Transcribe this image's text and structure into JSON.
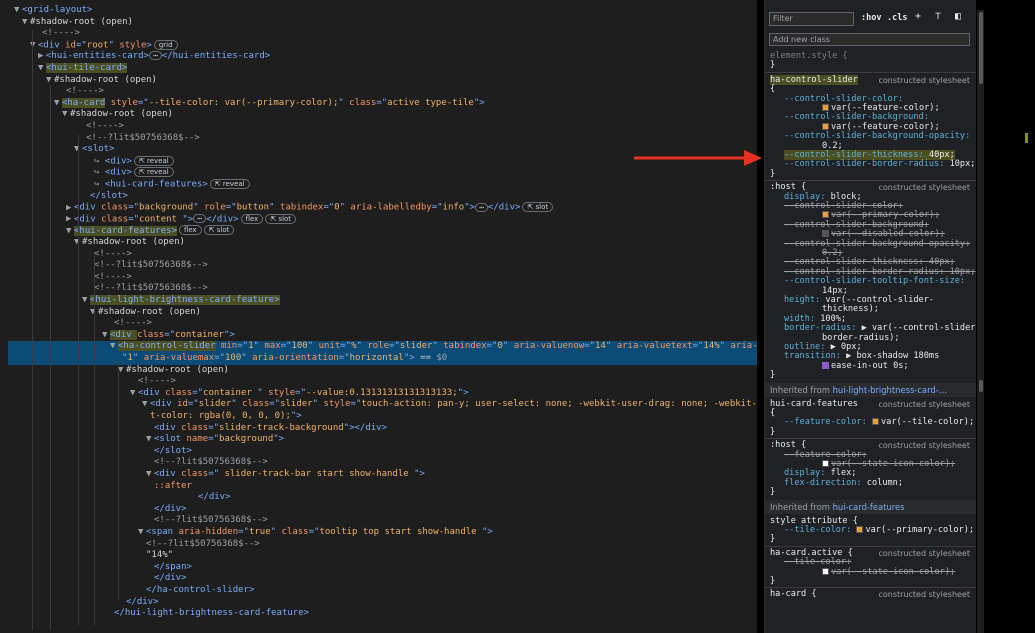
{
  "elements_panel": {
    "lines": [
      {
        "html": "<span class='tri'>▼</span><span class='tag'>&lt;grid-layout&gt;</span>"
      },
      {
        "html": "<span class='tri'>▼</span><span class='code'>#shadow-root (open)</span>"
      },
      {
        "html": "<span class='tri'></span><span class='cmt'>&lt;!----&gt;</span>"
      },
      {
        "html": "<span class='tri'>▼</span><span class='tag'>&lt;div </span><span class='attr'>id</span><span class='tag'>=\"</span><span class='val'>root</span><span class='tag'>\" </span><span class='attr'>style</span><span class='tag'>&gt;</span><span class='pill'>grid</span>"
      },
      {
        "html": "<span class='tri'>▶</span><span class='tag'>&lt;hui-entities-card&gt;</span><span class='ell'>⋯</span><span class='tag'>&lt;/hui-entities-card&gt;</span>"
      },
      {
        "html": "<span class='tri'>▼</span><span class='hl-tag'>&lt;hui-tile-card&gt;</span>"
      },
      {
        "html": "<span class='tri'>▼</span><span class='code'>#shadow-root (open)</span>"
      },
      {
        "html": "<span class='tri'></span><span class='cmt'>&lt;!----&gt;</span>"
      },
      {
        "html": "<span class='tri'>▼</span><span class='hl-tag'>&lt;ha-card</span><span class='tag'> </span><span class='attr'>style</span><span class='tag'>=\"</span><span class='val'>--tile-color: var(--primary-color);</span><span class='tag'>\" </span><span class='attr'>class</span><span class='tag'>=\"</span><span class='val'>active type-tile</span><span class='tag'>\"&gt;</span>"
      },
      {
        "html": "<span class='tri'>▼</span><span class='code'>#shadow-root (open)</span>"
      },
      {
        "html": "<span class='tri'></span><span class='cmt'>&lt;!----&gt;</span>"
      },
      {
        "html": "<span class='tri'></span><span class='cmt'>&lt;!--?lit$50756368$--&gt;</span>"
      },
      {
        "html": "<span class='tri'>▼</span><span class='tag'>&lt;slot&gt;</span>"
      },
      {
        "html": "<span class='tri'></span><span class='cmt'>↪ </span><span class='tag'>&lt;div&gt;</span><span class='pill'>⇱ reveal</span>"
      },
      {
        "html": "<span class='tri'></span><span class='cmt'>↪ </span><span class='tag'>&lt;div&gt;</span><span class='pill'>⇱ reveal</span>"
      },
      {
        "html": "<span class='tri'></span><span class='cmt'>↪ </span><span class='tag'>&lt;hui-card-features&gt;</span><span class='pill'>⇱ reveal</span>"
      },
      {
        "html": "<span class='tri'></span><span class='tag'>&lt;/slot&gt;</span>"
      },
      {
        "html": "<span class='tri'>▶</span><span class='tag'>&lt;div </span><span class='attr'>class</span><span class='tag'>=\"</span><span class='val'>background</span><span class='tag'>\" </span><span class='attr'>role</span><span class='tag'>=\"</span><span class='val'>button</span><span class='tag'>\" </span><span class='attr'>tabindex</span><span class='tag'>=\"</span><span class='val'>0</span><span class='tag'>\" </span><span class='attr'>aria-labelledby</span><span class='tag'>=\"</span><span class='val'>info</span><span class='tag'>\"&gt;</span><span class='ell'>⋯</span><span class='tag'>&lt;/div&gt;</span><span class='pill'>⇱ slot</span>"
      },
      {
        "html": "<span class='tri'>▶</span><span class='tag'>&lt;div </span><span class='attr'>class</span><span class='tag'>=\"</span><span class='val'>content   </span><span class='tag'>\"&gt;</span><span class='ell'>⋯</span><span class='tag'>&lt;/div&gt;</span><span class='pill'>flex</span><span class='pill'>⇱ slot</span>"
      },
      {
        "html": "<span class='tri'>▼</span><span class='hl-tag'>&lt;hui-card-features&gt;</span><span class='pill'>flex</span><span class='pill'>⇱ slot</span>"
      },
      {
        "html": "<span class='tri'>▼</span><span class='code'>#shadow-root (open)</span>"
      },
      {
        "html": "<span class='tri'></span><span class='cmt'>&lt;!----&gt;</span>"
      },
      {
        "html": "<span class='tri'></span><span class='cmt'>&lt;!--?lit$50756368$--&gt;</span>"
      },
      {
        "html": "<span class='tri'></span><span class='cmt'>&lt;!----&gt;</span>"
      },
      {
        "html": "<span class='tri'></span><span class='cmt'>&lt;!--?lit$50756368$--&gt;</span>"
      },
      {
        "html": "<span class='tri'>▼</span><span class='hl-tag'>&lt;hui-light-brightness-card-feature&gt;</span>"
      },
      {
        "html": "<span class='tri'>▼</span><span class='code'>#shadow-root (open)</span>"
      },
      {
        "html": "<span class='tri'></span><span class='cmt'>&lt;!----&gt;</span>"
      },
      {
        "html": "<span class='tri'>▼</span><span class='hl-tag'>&lt;div </span><span class='attr'>class</span><span class='tag'>=\"</span><span class='val'>container</span><span class='tag'>\"&gt;</span>"
      },
      {
        "html": "<span class='tri'>▼</span><span class='hl-tag'>&lt;ha-control-slider</span><span class='tag'> </span><span class='attr'>min</span><span class='tag'>=\"</span><span class='val'>1</span><span class='tag'>\" </span><span class='attr'>max</span><span class='tag'>=\"</span><span class='val'>100</span><span class='tag'>\" </span><span class='attr'>unit</span><span class='tag'>=\"</span><span class='val'>%</span><span class='tag'>\" </span><span class='attr'>role</span><span class='tag'>=\"</span><span class='val'>slider</span><span class='tag'>\" </span><span class='attr'>tabindex</span><span class='tag'>=\"</span><span class='val'>0</span><span class='tag'>\" </span><span class='attr'>aria-valuenow</span><span class='tag'>=\"</span><span class='val'>14</span><span class='tag'>\" </span><span class='attr'>aria-valuetext</span><span class='tag'>=\"</span><span class='val'>14%</span><span class='tag'>\" </span><span class='attr'>aria-valuemin</span><span class='tag'>=</span>"
      },
      {
        "html": "<span class='tri'></span><span class='tag'>\"</span><span class='val'>1</span><span class='tag'>\" </span><span class='attr'>aria-valuemax</span><span class='tag'>=\"</span><span class='val'>100</span><span class='tag'>\" </span><span class='attr'>aria-orientation</span><span class='tag'>=\"</span><span class='val'>horizontal</span><span class='tag'>\"&gt;</span><span class='code'> == </span><span class='cmt'>$0</span>"
      },
      {
        "html": "<span class='tri'>▼</span><span class='code'>#shadow-root (open)</span>"
      },
      {
        "html": "<span class='tri'></span><span class='cmt'>&lt;!----&gt;</span>"
      },
      {
        "html": "<span class='tri'>▼</span><span class='tag'>&lt;div </span><span class='attr'>class</span><span class='tag'>=\"</span><span class='val'>container  </span><span class='tag'>\" </span><span class='attr'>style</span><span class='tag'>=\"</span><span class='val'>--value:0.13131313131313133;</span><span class='tag'>\"&gt;</span>"
      },
      {
        "html": "<span class='tri'>▼</span><span class='tag'>&lt;div </span><span class='attr'>id</span><span class='tag'>=\"</span><span class='val'>slider</span><span class='tag'>\" </span><span class='attr'>class</span><span class='tag'>=\"</span><span class='val'>slider</span><span class='tag'>\" </span><span class='attr'>style</span><span class='tag'>=\"</span><span class='val'>touch-action: pan-y; user-select: none; -webkit-user-drag: none; -webkit-tap-highligh</span>"
      },
      {
        "html": "<span class='tri'></span><span class='val'>t-color: rgba(0, 0, 0, 0);</span><span class='tag'>\"&gt;</span>"
      },
      {
        "html": "<span class='tri'></span><span class='tag'>&lt;div </span><span class='attr'>class</span><span class='tag'>=\"</span><span class='val'>slider-track-background</span><span class='tag'>\"&gt;&lt;/div&gt;</span>"
      },
      {
        "html": "<span class='tri'>▼</span><span class='tag'>&lt;slot </span><span class='attr'>name</span><span class='tag'>=\"</span><span class='val'>background</span><span class='tag'>\"&gt;</span>"
      },
      {
        "html": "<span class='tri'></span><span class='tag'>&lt;/slot&gt;</span>"
      },
      {
        "html": "<span class='tri'></span><span class='cmt'>&lt;!--?lit$50756368$--&gt;</span>"
      },
      {
        "html": "<span class='tri'>▼</span><span class='tag'>&lt;div </span><span class='attr'>class</span><span class='tag'>=\"</span><span class='val'> slider-track-bar start show-handle </span><span class='tag'>\"&gt;</span>"
      },
      {
        "html": "<span class='tri'></span><span class='attr'>::after</span>"
      },
      {
        "html": "<span class='tri'></span><span class='tag'>&lt;/div&gt;</span>"
      },
      {
        "html": "<span class='tri'></span><span class='tag'>&lt;/div&gt;</span>"
      },
      {
        "html": "<span class='tri'></span><span class='cmt'>&lt;!--?lit$50756368$--&gt;</span>"
      },
      {
        "html": "<span class='tri'>▼</span><span class='tag'>&lt;span </span><span class='attr'>aria-hidden</span><span class='tag'>=\"</span><span class='val'>true</span><span class='tag'>\" </span><span class='attr'>class</span><span class='tag'>=\"</span><span class='val'>tooltip  top start show-handle </span><span class='tag'>\"&gt;</span>"
      },
      {
        "html": "<span class='tri'></span><span class='cmt'>&lt;!--?lit$50756368$--&gt;</span>"
      },
      {
        "html": "<span class='tri'></span><span class='code'>\"14%\"</span>"
      },
      {
        "html": "<span class='tri'></span><span class='tag'>&lt;/span&gt;</span>"
      },
      {
        "html": "<span class='tri'></span><span class='tag'>&lt;/div&gt;</span>"
      },
      {
        "html": "<span class='tri'></span><span class='tag'>&lt;/ha-control-slider&gt;</span>"
      },
      {
        "html": "<span class='tri'></span><span class='tag'>&lt;/div&gt;</span>"
      },
      {
        "html": "<span class='tri'></span><span class='tag'>&lt;/hui-light-brightness-card-feature&gt;</span>"
      }
    ]
  },
  "styles_panel": {
    "filter_placeholder": "Filter",
    "hov_label": ":hov",
    "cls_label": ".cls",
    "add_class_placeholder": "Add new class",
    "element_style": "element.style {",
    "close_brace": "}",
    "sections": {
      "ha_control_slider": {
        "selector": "ha-control-slider",
        "source": "constructed stylesheet",
        "decls": [
          {
            "prop": "--control-slider-color:",
            "value": ""
          },
          {
            "prop": "",
            "value": "var(--feature-color);",
            "swatch": "#e8a038"
          },
          {
            "prop": "--control-slider-background:",
            "value": ""
          },
          {
            "prop": "",
            "value": "var(--feature-color);",
            "swatch": "#e8a038"
          },
          {
            "prop": "--control-slider-background-opacity:",
            "value": ""
          },
          {
            "prop": "",
            "value": "0.2;"
          },
          {
            "prop": "--control-slider-thickness:",
            "value": "40px;",
            "highlight": true
          },
          {
            "prop": "--control-slider-border-radius:",
            "value": "10px;"
          }
        ]
      },
      "host": {
        "selector": ":host {",
        "source": "constructed stylesheet",
        "decls": [
          {
            "prop": "display:",
            "value": "block;"
          },
          {
            "prop": "--control-slider-color:",
            "value": "",
            "strike": true
          },
          {
            "prop": "",
            "value": "var(--primary-color);",
            "strike": true,
            "swatch": "#e8a038"
          },
          {
            "prop": "--control-slider-background:",
            "value": "",
            "strike": true
          },
          {
            "prop": "",
            "value": "var(--disabled-color);",
            "strike": true,
            "swatch": "#555555"
          },
          {
            "prop": "--control-slider-background-opacity:",
            "value": "",
            "strike": true
          },
          {
            "prop": "",
            "value": "0.2;",
            "strike": true
          },
          {
            "prop": "--control-slider-thickness:",
            "value": "40px;",
            "strike": true
          },
          {
            "prop": "--control-slider-border-radius:",
            "value": "10px;",
            "strike": true
          },
          {
            "prop": "--control-slider-tooltip-font-size:",
            "value": ""
          },
          {
            "prop": "",
            "value": "14px;"
          },
          {
            "prop": "height:",
            "value": "var(--control-slider-"
          },
          {
            "prop": "",
            "value": "thickness);"
          },
          {
            "prop": "width:",
            "value": "100%;"
          },
          {
            "prop": "border-radius:",
            "value": "▶ var(--control-slider-"
          },
          {
            "prop": "",
            "value": "border-radius);"
          },
          {
            "prop": "outline:",
            "value": "▶ 0px;"
          },
          {
            "prop": "transition:",
            "value": "▶ box-shadow 180ms"
          },
          {
            "prop": "",
            "value": "ease-in-out 0s;",
            "checkbox": true
          }
        ]
      },
      "inherited1_label": "Inherited from",
      "inherited1_link": "hui-light-brightness-card-…",
      "hui_card_features": {
        "selector": "hui-card-features",
        "source": "constructed stylesheet",
        "decls": [
          {
            "prop": "--feature-color:",
            "value": "var(--tile-color);",
            "swatch": "#e8a038"
          }
        ]
      },
      "host2": {
        "selector": ":host {",
        "source": "constructed stylesheet",
        "decls": [
          {
            "prop": "--feature-color:",
            "value": "",
            "strike": true
          },
          {
            "prop": "",
            "value": "var(--state-icon-color);",
            "strike": true,
            "swatch": "#ffffff"
          },
          {
            "prop": "display:",
            "value": "flex;",
            "dim": true
          },
          {
            "prop": "flex-direction:",
            "value": "column;",
            "dim": true
          }
        ]
      },
      "inherited2_label": "Inherited from",
      "inherited2_link": "hui-card-features",
      "style_attr": {
        "selector": "style attribute {",
        "decls": [
          {
            "prop": "--tile-color:",
            "value": "var(--primary-color);",
            "swatch": "#e8a038"
          }
        ]
      },
      "ha_card_active": {
        "selector": "ha-card.active {",
        "source": "constructed stylesheet",
        "decls": [
          {
            "prop": "--tile-color:",
            "value": "",
            "strike": true
          },
          {
            "prop": "",
            "value": "var(--state-icon-color);",
            "strike": true,
            "swatch": "#ffffff"
          }
        ]
      },
      "ha_card": {
        "selector": "ha-card {",
        "source": "constructed stylesheet"
      }
    }
  },
  "colors": {
    "accent": "#7cacf8",
    "arrow": "#e8311f",
    "selection": "#0b4b75"
  }
}
